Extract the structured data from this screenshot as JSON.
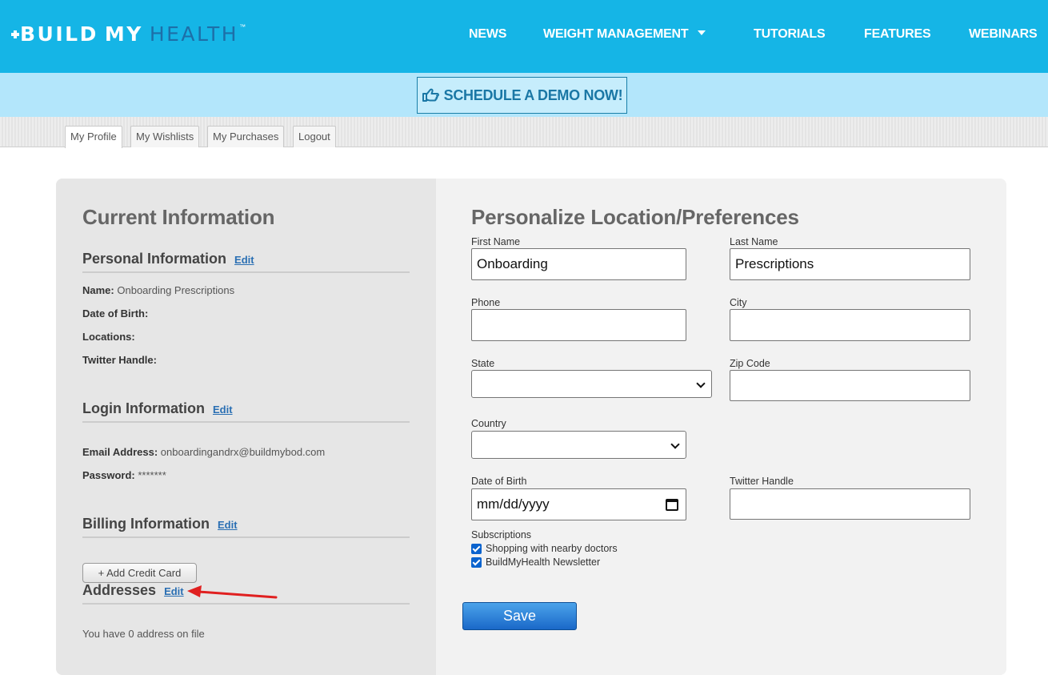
{
  "header": {
    "logo": {
      "build": "BUILD",
      "my": "MY",
      "health": "HEALTH",
      "tm": "™"
    },
    "nav": {
      "news": "NEWS",
      "weight_management": "WEIGHT MANAGEMENT",
      "tutorials": "TUTORIALS",
      "features": "FEATURES",
      "webinars": "WEBINARS"
    }
  },
  "banner": {
    "demo_label": "SCHEDULE A DEMO NOW!"
  },
  "tabs": [
    "My Profile",
    "My Wishlists",
    "My Purchases",
    "Logout"
  ],
  "current": {
    "title": "Current Information",
    "edit_label": "Edit",
    "personal": {
      "title": "Personal Information",
      "name_label": "Name:",
      "name_value": "Onboarding Prescriptions",
      "dob_label": "Date of Birth:",
      "locations_label": "Locations:",
      "twitter_label": "Twitter Handle:"
    },
    "login": {
      "title": "Login Information",
      "email_label": "Email Address:",
      "email_value": "onboardingandrx@buildmybod.com",
      "password_label": "Password:",
      "password_value": "*******"
    },
    "billing": {
      "title": "Billing Information",
      "add_card_label": "+ Add Credit Card"
    },
    "addresses": {
      "title": "Addresses",
      "count_text": "You have 0 address on file"
    }
  },
  "preferences": {
    "title": "Personalize Location/Preferences",
    "first_name_label": "First Name",
    "first_name_value": "Onboarding",
    "last_name_label": "Last Name",
    "last_name_value": "Prescriptions",
    "phone_label": "Phone",
    "city_label": "City",
    "state_label": "State",
    "zip_label": "Zip Code",
    "country_label": "Country",
    "dob_label": "Date of Birth",
    "dob_placeholder": "mm/dd/yyyy",
    "twitter_label": "Twitter Handle",
    "subscriptions_label": "Subscriptions",
    "subscriptions": [
      "Shopping with nearby doctors",
      "BuildMyHealth Newsletter"
    ],
    "save_label": "Save"
  },
  "colors": {
    "header_bg": "#15b5e6",
    "banner_bg": "#b3e6fb",
    "accent_link": "#2a6fb3",
    "annotation_arrow": "#e02020"
  }
}
